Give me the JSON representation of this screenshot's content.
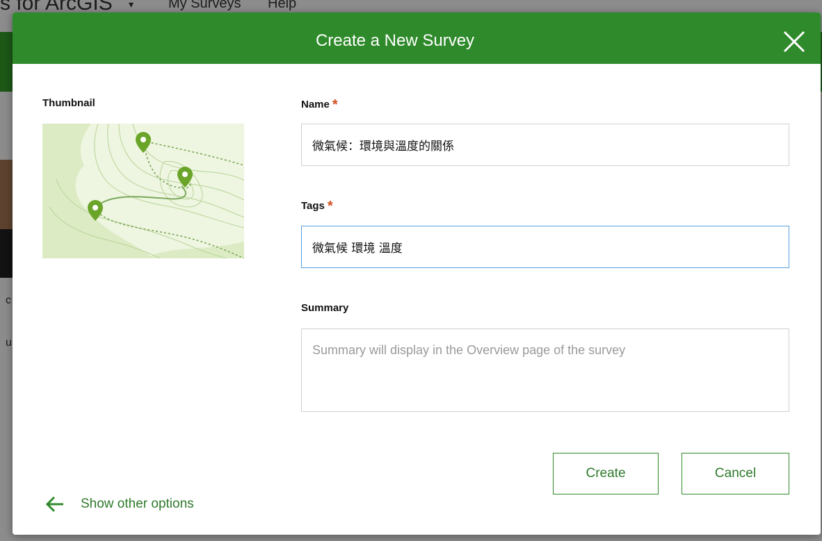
{
  "background": {
    "app_title": "s for ArcGIS",
    "nav_caret": "▾",
    "nav_items": [
      "My Surveys",
      "Help"
    ],
    "left_fragments": [
      "c",
      "u"
    ]
  },
  "modal": {
    "title": "Create a New Survey",
    "close_icon": "close-icon"
  },
  "thumbnail": {
    "label": "Thumbnail"
  },
  "form": {
    "name_label": "Name",
    "name_value": "微氣候：環境與溫度的關係",
    "tags_label": "Tags",
    "tags_value": "微氣候 環境 溫度",
    "summary_label": "Summary",
    "summary_placeholder": "Summary will display in the Overview page of the survey",
    "required_mark": "*"
  },
  "actions": {
    "create_label": "Create",
    "cancel_label": "Cancel",
    "back_label": "Show other options"
  },
  "colors": {
    "header_green": "#2f8a2b",
    "button_text_green": "#2f7a2b",
    "required_orange": "#d05020",
    "active_border": "#57a0e0"
  }
}
